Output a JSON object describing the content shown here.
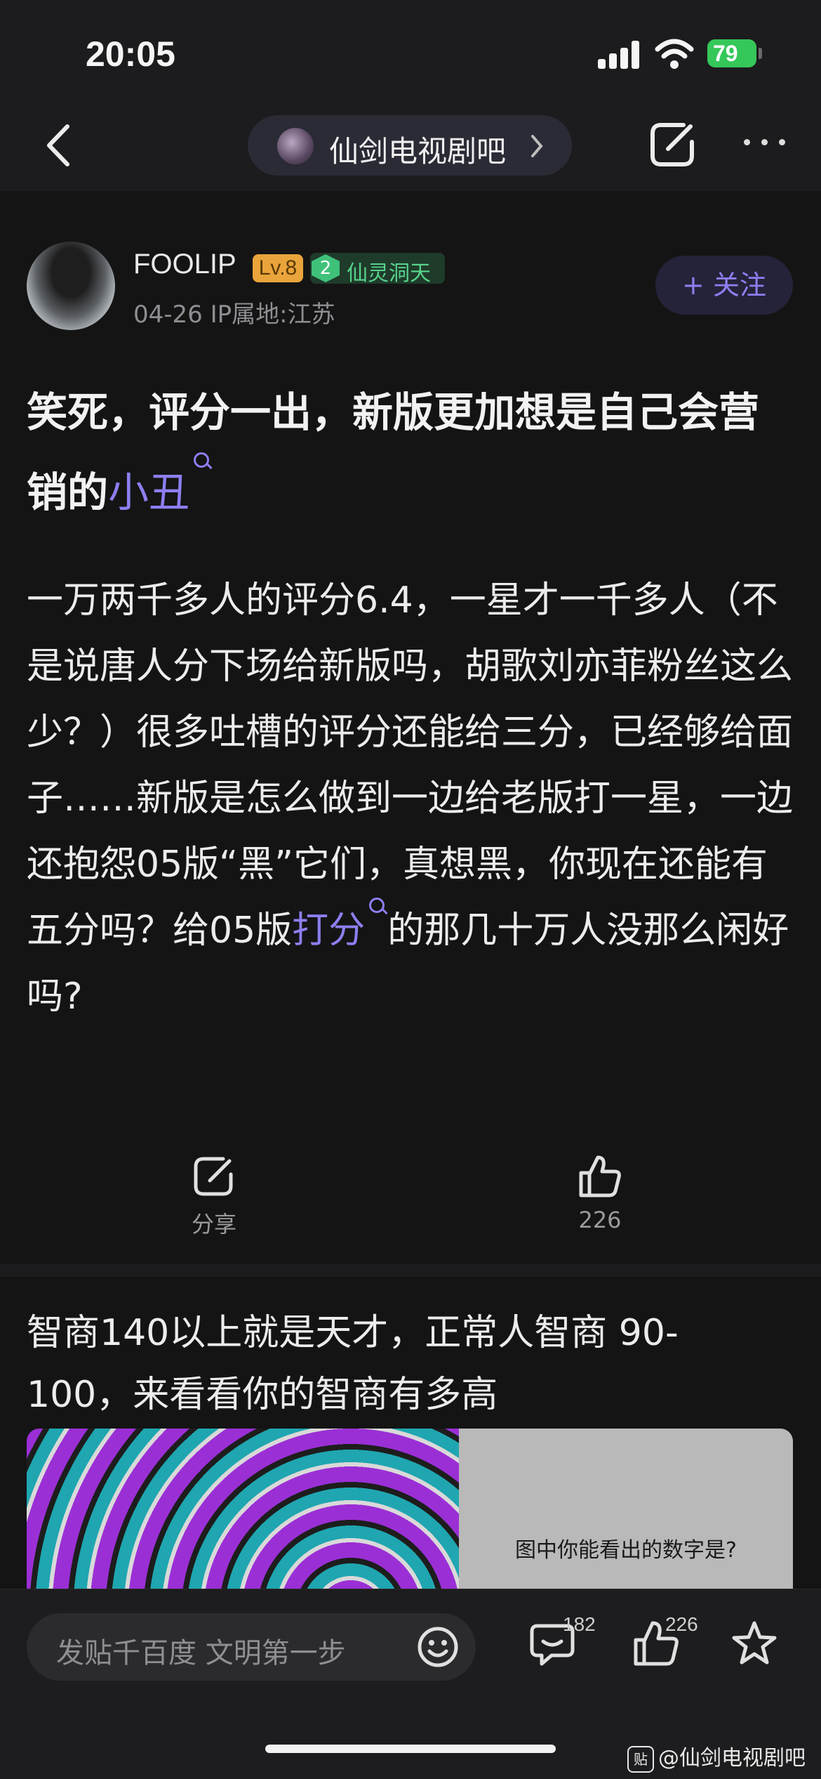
{
  "status_bar": {
    "time": "20:05",
    "battery": "79"
  },
  "nav": {
    "forum_name": "仙剑电视剧吧"
  },
  "post": {
    "username": "FOOLIP",
    "level": "Lv.8",
    "badge_level": "2",
    "badge_name": "仙灵洞天",
    "meta": "04-26  IP属地:江苏",
    "follow_label": "+ 关注",
    "title_part1": "笑死，评分一出，新版更加想是自己会营销的",
    "title_highlight": "小丑",
    "body_part1": "一万两千多人的评分6.4，一星才一千多人（不是说唐人分下场给新版吗，胡歌刘亦菲粉丝这么少？）很多吐槽的评分还能给三分，已经够给面子……新版是怎么做到一边给老版打一星，一边还抱怨05版“黑”它们，真想黑，你现在还能有五分吗？给05版",
    "body_highlight": "打分",
    "body_part2": "的那几十万人没那么闲好吗?",
    "share_label": "分享",
    "like_count": "226"
  },
  "ad": {
    "text": "智商140以上就是天才，正常人智商 90-100，来看看你的智商有多高",
    "image_caption": "图中你能看出的数字是?"
  },
  "bottom_bar": {
    "input_placeholder": "发贴千百度 文明第一步",
    "comment_count": "182",
    "like_count": "226"
  },
  "watermark": {
    "icon_text": "贴",
    "text": "@仙剑电视剧吧"
  },
  "colors": {
    "accent": "#8c7ff0",
    "level_badge": "#e9a43b",
    "tag_green": "#56d38c",
    "battery": "#35c759"
  }
}
